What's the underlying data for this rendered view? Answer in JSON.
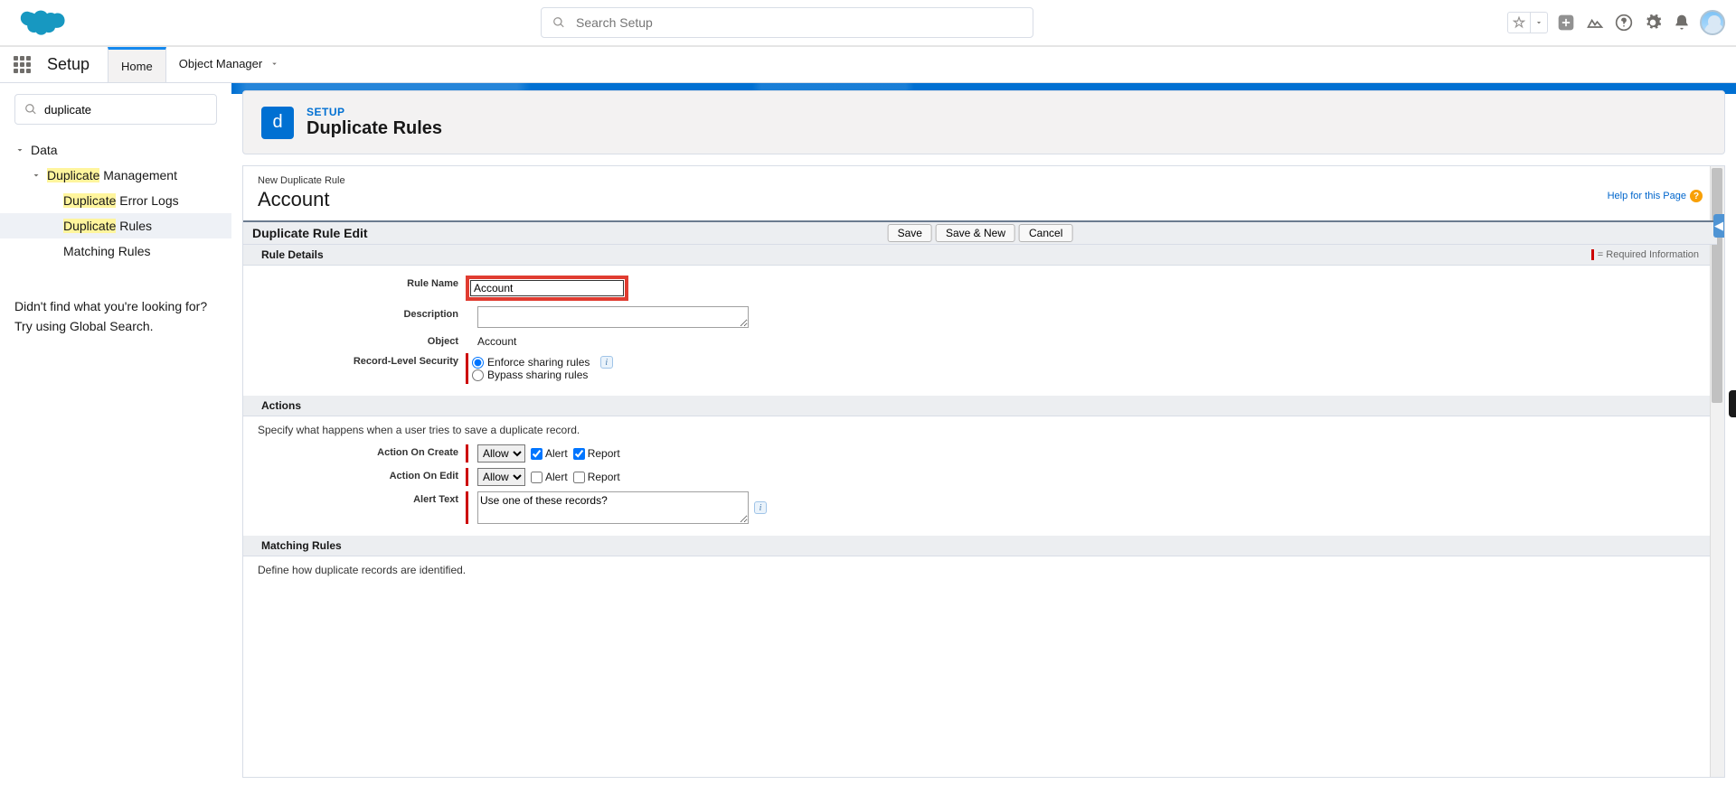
{
  "header": {
    "search_placeholder": "Search Setup"
  },
  "context": {
    "app_name": "Setup",
    "tab_home": "Home",
    "tab_object_manager": "Object Manager"
  },
  "sidebar": {
    "search_value": "duplicate",
    "root": "Data",
    "group": "Management",
    "group_hl": "Duplicate",
    "items": [
      {
        "hl": "Duplicate",
        "rest": " Error Logs"
      },
      {
        "hl": "Duplicate",
        "rest": " Rules"
      },
      {
        "hl": "",
        "rest": "Matching Rules"
      }
    ],
    "hint_line1": "Didn't find what you're looking for?",
    "hint_line2": "Try using Global Search."
  },
  "page": {
    "eyebrow": "SETUP",
    "title": "Duplicate Rules",
    "icon_letter": "d"
  },
  "form": {
    "new_label": "New Duplicate Rule",
    "entity": "Account",
    "help_link": "Help for this Page",
    "edit_title": "Duplicate Rule Edit",
    "buttons": {
      "save": "Save",
      "save_new": "Save & New",
      "cancel": "Cancel"
    },
    "section_rule_details": "Rule Details",
    "required_info": "= Required Information",
    "labels": {
      "rule_name": "Rule Name",
      "description": "Description",
      "object": "Object",
      "security": "Record-Level Security",
      "action_create": "Action On Create",
      "action_edit": "Action On Edit",
      "alert_text": "Alert Text"
    },
    "values": {
      "rule_name": "Account",
      "object": "Account",
      "security_enforce": "Enforce sharing rules",
      "security_bypass": "Bypass sharing rules",
      "alert_text": "Use one of these records?"
    },
    "section_actions": "Actions",
    "actions_desc": "Specify what happens when a user tries to save a duplicate record.",
    "action_option": "Allow",
    "chk_alert": "Alert",
    "chk_report": "Report",
    "section_matching": "Matching Rules",
    "matching_desc": "Define how duplicate records are identified."
  }
}
